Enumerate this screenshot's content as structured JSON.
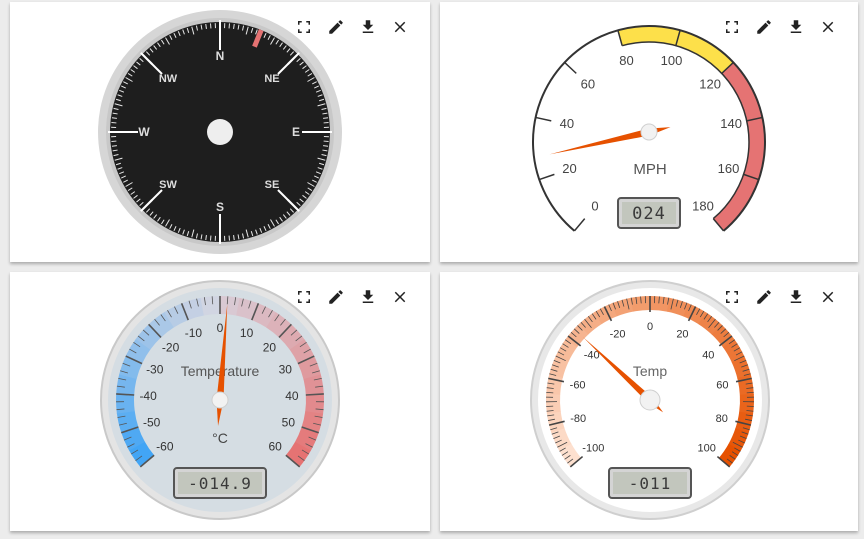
{
  "toolbar": {
    "icons": [
      "fullscreen-icon",
      "edit-icon",
      "download-icon",
      "close-icon"
    ]
  },
  "compass": {
    "directions": {
      "n": "N",
      "ne": "NE",
      "e": "E",
      "se": "SE",
      "s": "S",
      "sw": "SW",
      "w": "W",
      "nw": "NW"
    },
    "heading_deg": 22,
    "colors": {
      "face": "#1e1e1e",
      "bezel": "#d6d6d6",
      "needle": "#e57373",
      "ticks": "#ffffff"
    }
  },
  "speedometer": {
    "unit": "MPH",
    "scale_labels": [
      "0",
      "20",
      "40",
      "60",
      "80",
      "100",
      "120",
      "140",
      "160",
      "180"
    ],
    "min": 0,
    "max": 180,
    "value": 24,
    "display": "024",
    "bands": [
      {
        "from": 80,
        "to": 120,
        "color": "#fde04a"
      },
      {
        "from": 120,
        "to": 180,
        "color": "#e57373"
      }
    ],
    "colors": {
      "needle": "#e65100",
      "lcd_bg": "#c2c6bd",
      "lcd_text": "#3a3a3a"
    }
  },
  "thermometer": {
    "title": "Temperature",
    "unit": "°C",
    "scale_labels": [
      "-60",
      "-50",
      "-40",
      "-30",
      "-20",
      "-10",
      "0",
      "10",
      "20",
      "30",
      "40",
      "50",
      "60"
    ],
    "min": -60,
    "max": 60,
    "value": 2,
    "display": "-014.9",
    "colors": {
      "face": "#d5dde3",
      "cold": "#42a5f5",
      "hot": "#e57373",
      "needle": "#e65100"
    }
  },
  "temp_gauge": {
    "title": "Temp",
    "scale_labels": [
      "-100",
      "-80",
      "-60",
      "-40",
      "-20",
      "0",
      "20",
      "40",
      "60",
      "80",
      "100"
    ],
    "min": -100,
    "max": 100,
    "value": -36,
    "display": "-011",
    "colors": {
      "face": "#ffffff",
      "low": "#fde0cf",
      "high": "#e65100",
      "needle": "#e65100"
    }
  }
}
